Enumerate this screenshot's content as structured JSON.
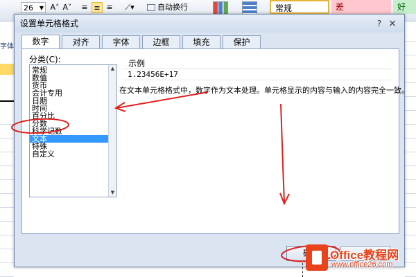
{
  "ribbon": {
    "font_size": "26",
    "grow_font": "A˄",
    "shrink_font": "A˅",
    "wrap_text": "自动换行",
    "styles": {
      "normal": "常规",
      "bad": "差",
      "good": "好"
    },
    "font_group_label": "字体"
  },
  "dialog": {
    "title": "设置单元格格式",
    "close": "×",
    "help": "?",
    "tabs": [
      "数字",
      "对齐",
      "字体",
      "边框",
      "填充",
      "保护"
    ],
    "active_tab": "数字",
    "category_label": "分类(C):",
    "categories": [
      "常规",
      "数值",
      "货币",
      "会计专用",
      "日期",
      "时间",
      "百分比",
      "分数",
      "科学记数",
      "文本",
      "特殊",
      "自定义"
    ],
    "selected_category": "文本",
    "sample_label": "示例",
    "sample_value": "1.23456E+17",
    "description": "在文本单元格格式中，数字作为文本处理。单元格显示的内容与输入的内容完全一致。",
    "ok_label": "确定"
  },
  "watermark": {
    "brand": "Office教程网",
    "url": "www.office26.com"
  },
  "colors": {
    "dialog_bg": "#dbe4f1",
    "selection": "#3399ff",
    "annotation": "#e0201c",
    "brand": "#e8431b"
  }
}
